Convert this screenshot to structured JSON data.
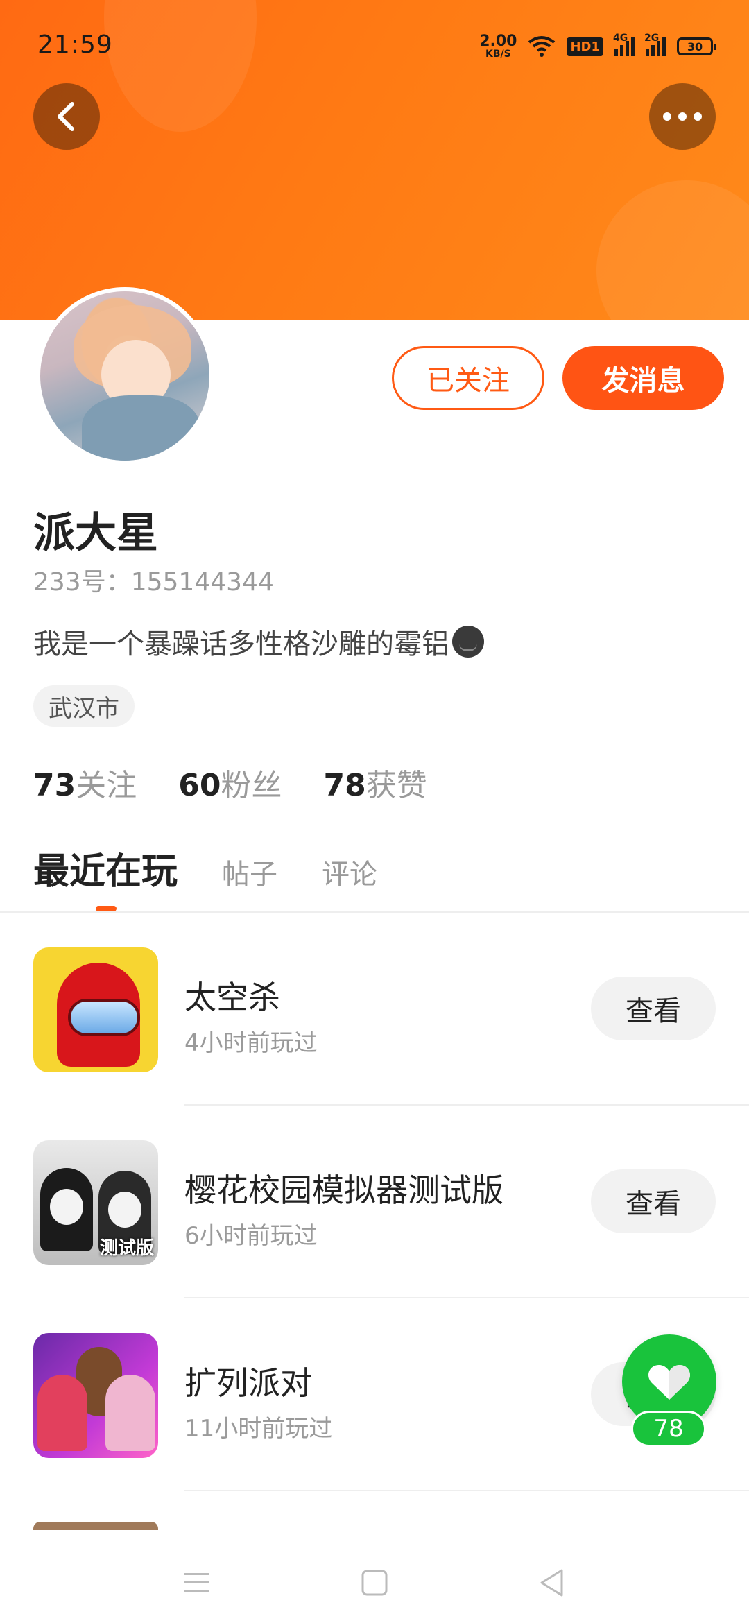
{
  "status_bar": {
    "time": "21:59",
    "net_speed_value": "2.00",
    "net_speed_unit": "KB/S",
    "hd_label": "HD1",
    "signal1_label": "4G",
    "signal2_label": "2G",
    "battery": "30"
  },
  "header": {
    "back_icon": "chevron-left-icon",
    "more_icon": "more-horizontal-icon",
    "banner_color": "#ff7a14"
  },
  "profile": {
    "follow_button": "已关注",
    "message_button": "发消息",
    "name": "派大星",
    "id_text": "233号：155144344",
    "bio": "我是一个暴躁话多性格沙雕的霉铝",
    "location": "武汉市",
    "accent_color": "#ff5414"
  },
  "stats": [
    {
      "num": "73",
      "label": "关注"
    },
    {
      "num": "60",
      "label": "粉丝"
    },
    {
      "num": "78",
      "label": "获赞"
    }
  ],
  "tabs": [
    {
      "label": "最近在玩",
      "active": true
    },
    {
      "label": "帖子"
    },
    {
      "label": "评论"
    }
  ],
  "games": [
    {
      "title": "太空杀",
      "played": "4小时前玩过",
      "action": "查看"
    },
    {
      "title": "樱花校园模拟器测试版",
      "played": "6小时前玩过",
      "action": "查看",
      "icon_tag": "测试版"
    },
    {
      "title": "扩列派对",
      "played": "11小时前玩过",
      "action": "查看"
    }
  ],
  "like_fab": {
    "count": "78",
    "icon": "heart-icon",
    "color": "#19c33c"
  },
  "nav": {
    "menu_icon": "menu-icon",
    "home_icon": "square-home-icon",
    "back_icon": "triangle-back-icon"
  }
}
